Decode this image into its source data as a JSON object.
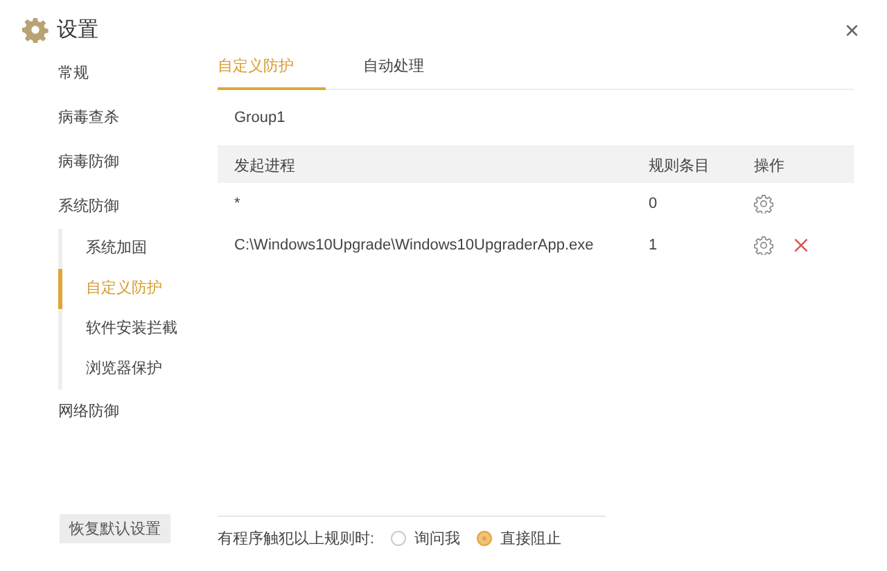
{
  "window": {
    "title": "设置",
    "close": "×"
  },
  "sidebar": {
    "items": [
      {
        "label": "常规",
        "selected": false
      },
      {
        "label": "病毒查杀",
        "selected": false
      },
      {
        "label": "病毒防御",
        "selected": false
      },
      {
        "label": "系统防御",
        "selected": false,
        "children": [
          {
            "label": "系统加固",
            "selected": false
          },
          {
            "label": "自定义防护",
            "selected": true
          },
          {
            "label": "软件安装拦截",
            "selected": false
          },
          {
            "label": "浏览器保护",
            "selected": false
          }
        ]
      },
      {
        "label": "网络防御",
        "selected": false
      }
    ],
    "reset_button": "恢复默认设置"
  },
  "tabs": [
    {
      "label": "自定义防护",
      "selected": true
    },
    {
      "label": "自动处理",
      "selected": false
    }
  ],
  "group": "Group1",
  "table": {
    "columns": [
      "发起进程",
      "规则条目",
      "操作"
    ],
    "rows": [
      {
        "process": "*",
        "count": "0",
        "deletable": false
      },
      {
        "process": "C:\\Windows10Upgrade\\Windows10UpgraderApp.exe",
        "count": "1",
        "deletable": true
      }
    ]
  },
  "action": {
    "label": "有程序触犯以上规则时:",
    "options": [
      {
        "label": "询问我",
        "selected": false
      },
      {
        "label": "直接阻止",
        "selected": true
      }
    ]
  }
}
